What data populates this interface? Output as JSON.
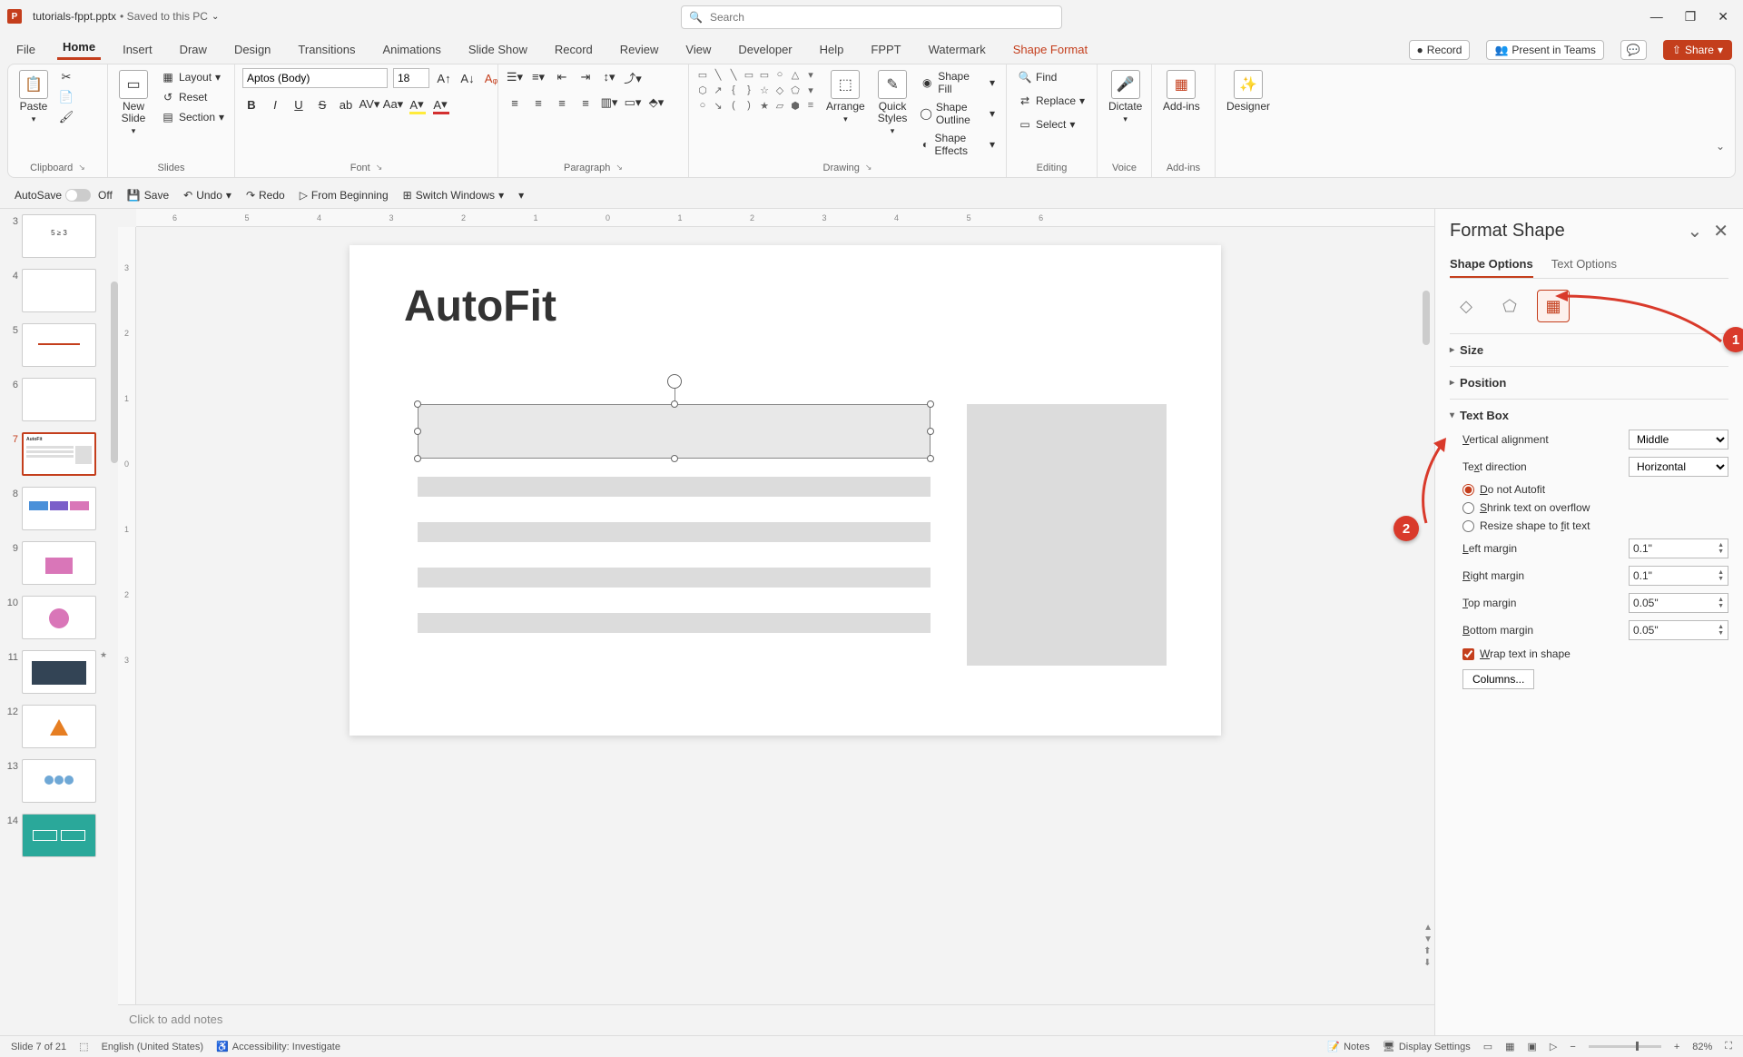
{
  "title": {
    "filename": "tutorials-fppt.pptx",
    "saved_status": "Saved to this PC",
    "app_letter": "P"
  },
  "search": {
    "placeholder": "Search"
  },
  "window_controls": {
    "min": "—",
    "max": "❐",
    "close": "✕"
  },
  "tabs": {
    "file": "File",
    "home": "Home",
    "insert": "Insert",
    "draw": "Draw",
    "design": "Design",
    "transitions": "Transitions",
    "animations": "Animations",
    "slideshow": "Slide Show",
    "record": "Record",
    "review": "Review",
    "view": "View",
    "developer": "Developer",
    "help": "Help",
    "fppt": "FPPT",
    "watermark": "Watermark",
    "shapeformat": "Shape Format",
    "record_btn": "Record",
    "present": "Present in Teams",
    "share": "Share"
  },
  "ribbon": {
    "clipboard": {
      "paste": "Paste",
      "cut": "",
      "copy": "",
      "fmt": "",
      "label": "Clipboard"
    },
    "slides": {
      "newslide": "New\nSlide",
      "layout": "Layout",
      "reset": "Reset",
      "section": "Section",
      "label": "Slides"
    },
    "font": {
      "name": "Aptos (Body)",
      "size": "18",
      "label": "Font"
    },
    "paragraph": {
      "label": "Paragraph"
    },
    "drawing": {
      "arrange": "Arrange",
      "quick": "Quick\nStyles",
      "fill": "Shape Fill",
      "outline": "Shape Outline",
      "effects": "Shape Effects",
      "label": "Drawing"
    },
    "editing": {
      "find": "Find",
      "replace": "Replace",
      "select": "Select",
      "label": "Editing"
    },
    "voice": {
      "dictate": "Dictate",
      "label": "Voice"
    },
    "addins": {
      "addins": "Add-ins",
      "label": "Add-ins"
    },
    "designer": {
      "designer": "Designer"
    }
  },
  "qat": {
    "autosave": "AutoSave",
    "autosave_state": "Off",
    "save": "Save",
    "undo": "Undo",
    "redo": "Redo",
    "frombeginning": "From Beginning",
    "switchwindows": "Switch Windows"
  },
  "thumbnails": {
    "items": [
      {
        "num": "3",
        "label": "5 ≥ 3"
      },
      {
        "num": "4",
        "label": ""
      },
      {
        "num": "5",
        "label": ""
      },
      {
        "num": "6",
        "label": ""
      },
      {
        "num": "7",
        "label": "AutoFit"
      },
      {
        "num": "8",
        "label": ""
      },
      {
        "num": "9",
        "label": ""
      },
      {
        "num": "10",
        "label": ""
      },
      {
        "num": "11",
        "label": ""
      },
      {
        "num": "12",
        "label": ""
      },
      {
        "num": "13",
        "label": ""
      },
      {
        "num": "14",
        "label": ""
      }
    ]
  },
  "slide": {
    "title": "AutoFit"
  },
  "notes": {
    "placeholder": "Click to add notes"
  },
  "pane": {
    "title": "Format Shape",
    "tabs": {
      "shape": "Shape Options",
      "text": "Text Options"
    },
    "sections": {
      "size": "Size",
      "position": "Position",
      "textbox": "Text Box"
    },
    "valign_label": "Vertical alignment",
    "valign_value": "Middle",
    "tdir_label": "Text direction",
    "tdir_value": "Horizontal",
    "autofit": {
      "none": "Do not Autofit",
      "shrink": "Shrink text on overflow",
      "resize": "Resize shape to fit text"
    },
    "margins": {
      "left_label": "Left margin",
      "left_value": "0.1\"",
      "right_label": "Right margin",
      "right_value": "0.1\"",
      "top_label": "Top margin",
      "top_value": "0.05\"",
      "bottom_label": "Bottom margin",
      "bottom_value": "0.05\""
    },
    "wrap": "Wrap text in shape",
    "columns": "Columns..."
  },
  "status": {
    "slide_info": "Slide 7 of 21",
    "lang": "English (United States)",
    "accessibility": "Accessibility: Investigate",
    "notes": "Notes",
    "display": "Display Settings",
    "zoom": "82%"
  },
  "callouts": {
    "one": "1",
    "two": "2"
  }
}
